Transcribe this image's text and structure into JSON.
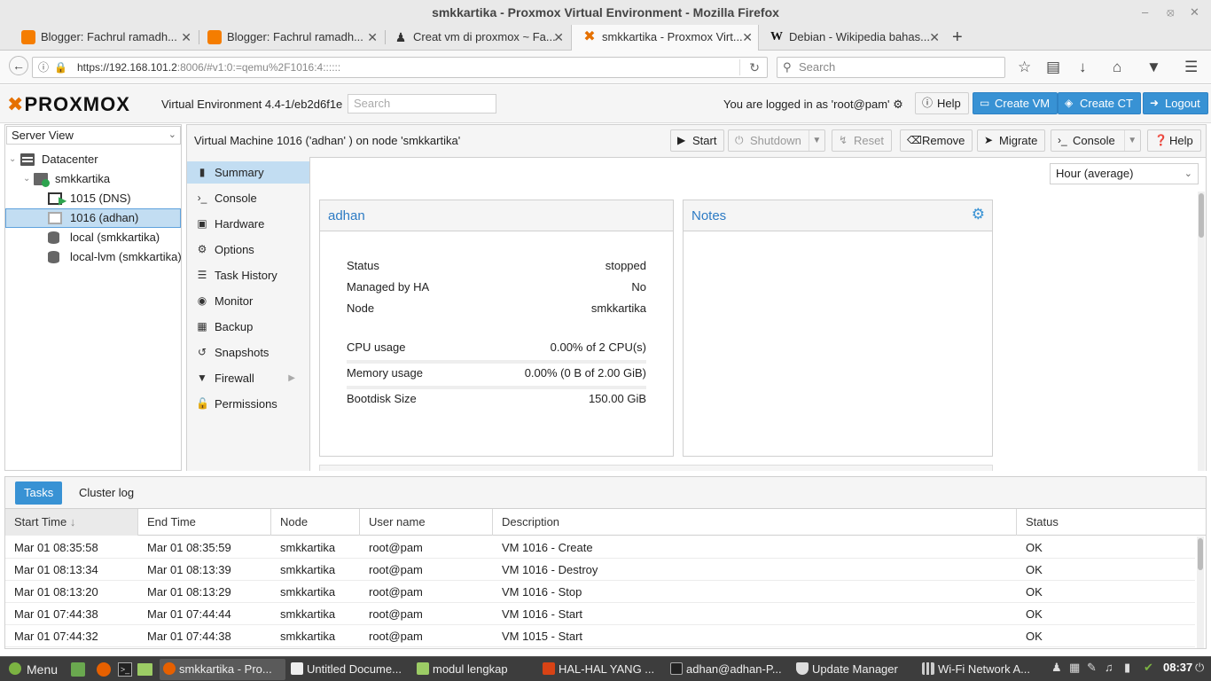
{
  "window": {
    "title": "smkkartika - Proxmox Virtual Environment - Mozilla Firefox"
  },
  "browser": {
    "tabs": [
      {
        "label": "Blogger: Fachrul ramadh...",
        "icon": "blogger-icon"
      },
      {
        "label": "Blogger: Fachrul ramadh...",
        "icon": "blogger-icon"
      },
      {
        "label": "Creat vm di proxmox ~ Fa...",
        "icon": "person-icon"
      },
      {
        "label": "smkkartika - Proxmox Virt...",
        "icon": "proxmox-icon",
        "active": true
      },
      {
        "label": "Debian - Wikipedia bahas...",
        "icon": "wikipedia-icon"
      }
    ],
    "url_host": "https://192.168.101.2",
    "url_rest": ":8006/#v1:0:=qemu%2F1016:4::::::",
    "search_placeholder": "Search"
  },
  "pve": {
    "logo": "PROXMOX",
    "version": "Virtual Environment 4.4-1/eb2d6f1e",
    "search_placeholder": "Search",
    "logged_in": "You are logged in as 'root@pam'",
    "buttons": {
      "help": "Help",
      "create_vm": "Create VM",
      "create_ct": "Create CT",
      "logout": "Logout"
    }
  },
  "tree": {
    "view": "Server View",
    "items": [
      {
        "label": "Datacenter"
      },
      {
        "label": "smkkartika"
      },
      {
        "label": "1015 (DNS)"
      },
      {
        "label": "1016 (adhan)",
        "selected": true
      },
      {
        "label": "local (smkkartika)"
      },
      {
        "label": "local-lvm (smkkartika)"
      }
    ]
  },
  "vm": {
    "title": "Virtual Machine 1016 ('adhan' ) on node 'smkkartika'",
    "toolbar": {
      "start": "Start",
      "shutdown": "Shutdown",
      "reset": "Reset",
      "remove": "Remove",
      "migrate": "Migrate",
      "console": "Console",
      "help": "Help"
    },
    "menu": [
      {
        "label": "Summary",
        "icon": "book-icon",
        "selected": true
      },
      {
        "label": "Console",
        "icon": "terminal-icon"
      },
      {
        "label": "Hardware",
        "icon": "monitor-icon"
      },
      {
        "label": "Options",
        "icon": "gear-icon"
      },
      {
        "label": "Task History",
        "icon": "list-icon"
      },
      {
        "label": "Monitor",
        "icon": "eye-icon"
      },
      {
        "label": "Backup",
        "icon": "floppy-icon"
      },
      {
        "label": "Snapshots",
        "icon": "history-icon"
      },
      {
        "label": "Firewall",
        "icon": "shield-icon"
      },
      {
        "label": "Permissions",
        "icon": "unlock-icon"
      }
    ],
    "timeframe": "Hour (average)",
    "summary": {
      "name": "adhan",
      "rows": [
        {
          "key": "Status",
          "value": "stopped"
        },
        {
          "key": "Managed by HA",
          "value": "No"
        },
        {
          "key": "Node",
          "value": "smkkartika"
        },
        {
          "key": "CPU usage",
          "value": "0.00% of 2 CPU(s)"
        },
        {
          "key": "Memory usage",
          "value": "0.00% (0 B of 2.00 GiB)"
        },
        {
          "key": "Bootdisk Size",
          "value": "150.00 GiB"
        }
      ]
    },
    "notes": {
      "title": "Notes"
    }
  },
  "tasks": {
    "tabs": [
      "Tasks",
      "Cluster log"
    ],
    "columns": [
      "Start Time",
      "End Time",
      "Node",
      "User name",
      "Description",
      "Status"
    ],
    "rows": [
      [
        "Mar 01 08:35:58",
        "Mar 01 08:35:59",
        "smkkartika",
        "root@pam",
        "VM 1016 - Create",
        "OK"
      ],
      [
        "Mar 01 08:13:34",
        "Mar 01 08:13:39",
        "smkkartika",
        "root@pam",
        "VM 1016 - Destroy",
        "OK"
      ],
      [
        "Mar 01 08:13:20",
        "Mar 01 08:13:29",
        "smkkartika",
        "root@pam",
        "VM 1016 - Stop",
        "OK"
      ],
      [
        "Mar 01 07:44:38",
        "Mar 01 07:44:44",
        "smkkartika",
        "root@pam",
        "VM 1016 - Start",
        "OK"
      ],
      [
        "Mar 01 07:44:32",
        "Mar 01 07:44:38",
        "smkkartika",
        "root@pam",
        "VM 1015 - Start",
        "OK"
      ]
    ]
  },
  "taskbar": {
    "menu": "Menu",
    "items": [
      {
        "label": "smkkartika - Pro...",
        "active": true
      },
      {
        "label": "Untitled Docume..."
      },
      {
        "label": "modul lengkap"
      },
      {
        "label": "HAL-HAL YANG ..."
      },
      {
        "label": "adhan@adhan-P..."
      },
      {
        "label": "Update Manager"
      },
      {
        "label": "Wi-Fi Network A..."
      }
    ],
    "clock": "08:37"
  }
}
